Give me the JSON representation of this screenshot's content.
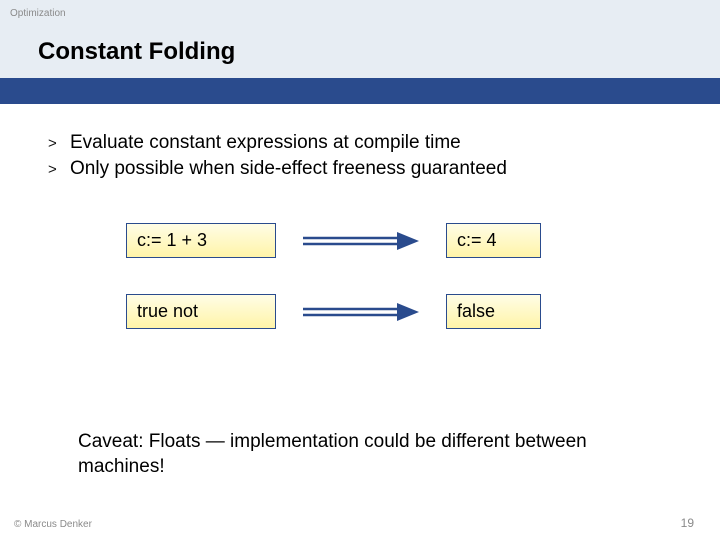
{
  "header": {
    "topic": "Optimization",
    "title": "Constant Folding"
  },
  "bullets": [
    "Evaluate constant expressions at compile time",
    "Only possible when side-effect freeness guaranteed"
  ],
  "examples": [
    {
      "left": "c:= 1 + 3",
      "right": "c:= 4"
    },
    {
      "left": "true not",
      "right": "false"
    }
  ],
  "caveat": "Caveat: Floats — implementation could be different between machines!",
  "footer": {
    "copyright": "© Marcus Denker",
    "page": "19"
  },
  "colors": {
    "headerStrip": "#e7edf3",
    "blueBar": "#2a4b8d",
    "arrow": "#2a4b8d",
    "boxBorder": "#2a4b8d"
  }
}
